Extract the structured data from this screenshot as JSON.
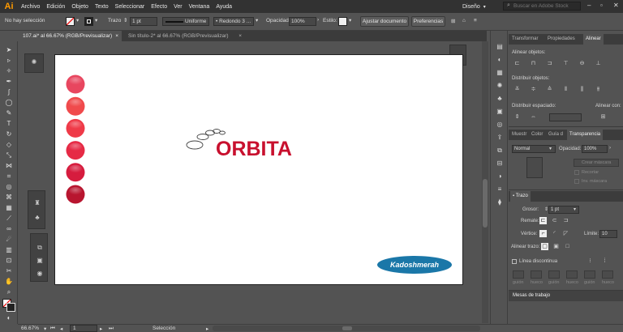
{
  "app": {
    "logo": "Ai",
    "menu": [
      "Archivo",
      "Edición",
      "Objeto",
      "Texto",
      "Seleccionar",
      "Efecto",
      "Ver",
      "Ventana",
      "Ayuda"
    ],
    "workspace": "Diseño",
    "search_placeholder": "Buscar en Adobe Stock"
  },
  "control_bar": {
    "selection": "No hay selección",
    "stroke_label": "Trazo",
    "stroke_weight": "1 pt",
    "profile": "Uniforme",
    "brush": "Redondo 3 ...",
    "opacity_label": "Opacidad:",
    "opacity": "100%",
    "style_label": "Estilo:",
    "doc_setup": "Ajustar documento",
    "preferences": "Preferencias"
  },
  "tabs": [
    {
      "label": "107.ai* al 66.67% (RGB/Previsualizar)",
      "close": "×"
    },
    {
      "label": "Sin título-2* al 66.67% (RGB/Previsualizar)",
      "close": "×"
    }
  ],
  "artwork": {
    "logo_text": "ORBITA",
    "badge_text": "Kadoshmerah",
    "circle_colors": [
      "#e8465f",
      "#f04a4c",
      "#ef3a48",
      "#e62a45",
      "#d61c3e",
      "#b8152f"
    ],
    "brand_red": "#c8102e",
    "badge_color": "#1a77a8"
  },
  "panels": {
    "top_tabs": [
      "Transformar",
      "Propiedades",
      "Alinear"
    ],
    "align_objects": "Alinear objetos:",
    "distribute_objects": "Distribuir objetos:",
    "distribute_spacing": "Distribuir espaciado:",
    "align_to": "Alinear con:",
    "mid_tabs": [
      "Muestr",
      "Color",
      "Guía d",
      "Transparencia"
    ],
    "blend_mode": "Normal",
    "opacity_label": "Opacidad:",
    "opacity": "100%",
    "make_mask": "Crear máscara",
    "clip": "Recortar",
    "invert_mask": "Inv. máscara",
    "stroke_title": "Trazo",
    "weight_label": "Grosor:",
    "weight": "1 pt",
    "caps_label": "Remate:",
    "corner_label": "Vértice:",
    "limit_label": "Límite:",
    "limit": "10",
    "align_stroke_label": "Alinear trazo:",
    "dashed_label": "Línea discontinua",
    "dash_labels": [
      "guión",
      "hueco",
      "guión",
      "hueco",
      "guión",
      "hueco"
    ],
    "workspaces_title": "Mesas de trabajo"
  },
  "status_bar": {
    "zoom": "66.67%",
    "artboard": "1",
    "tool": "Selección"
  }
}
